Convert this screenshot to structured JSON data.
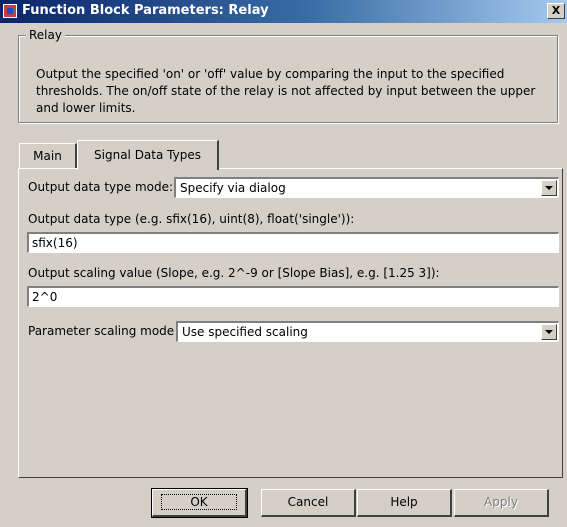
{
  "window": {
    "title": "Function Block Parameters: Relay",
    "close_label": "X"
  },
  "group": {
    "label": "Relay",
    "description": "Output the specified 'on' or 'off' value by comparing the input to the specified thresholds.  The on/off state of the relay is not affected by input between the upper and lower limits."
  },
  "tabs": [
    {
      "label": "Main",
      "selected": false
    },
    {
      "label": "Signal Data Types",
      "selected": true
    }
  ],
  "form": {
    "output_mode_label": "Output data type mode:",
    "output_mode_value": "Specify via dialog",
    "output_type_label": "Output data type (e.g. sfix(16), uint(8), float('single')):",
    "output_type_value": "sfix(16)",
    "output_scaling_label": "Output scaling value (Slope, e.g. 2^-9 or [Slope Bias], e.g. [1.25 3]):",
    "output_scaling_value": "2^0",
    "param_scaling_label": "Parameter scaling mode",
    "param_scaling_value": "Use specified scaling"
  },
  "buttons": {
    "ok": "OK",
    "cancel": "Cancel",
    "help": "Help",
    "apply": "Apply"
  }
}
